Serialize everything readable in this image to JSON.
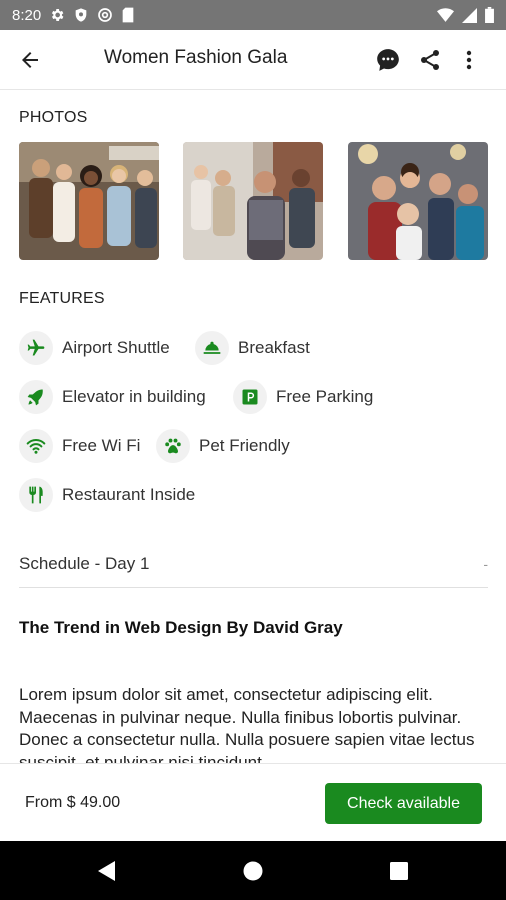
{
  "status_bar": {
    "time": "8:20",
    "left_icons": [
      "gear-icon",
      "shield-icon",
      "at-sign-icon",
      "sim-card-icon"
    ],
    "right_icons": [
      "wifi-icon",
      "signal-icon",
      "battery-icon"
    ]
  },
  "app_bar": {
    "title": "Women Fashion Gala",
    "back_icon": "arrow-back-icon",
    "actions": [
      "chat-icon",
      "share-icon",
      "more-vert-icon"
    ]
  },
  "photos": {
    "label": "PHOTOS",
    "items": [
      "photo-group-smiling",
      "photo-audience-seated",
      "photo-selfie-group"
    ]
  },
  "features": {
    "label": "FEATURES",
    "items": [
      {
        "label": "Airport Shuttle",
        "icon": "airplane-icon"
      },
      {
        "label": "Breakfast",
        "icon": "room-service-icon"
      },
      {
        "label": "Elevator in building",
        "icon": "rocket-icon"
      },
      {
        "label": "Free Parking",
        "icon": "parking-icon"
      },
      {
        "label": "Free Wi Fi",
        "icon": "wifi-icon"
      },
      {
        "label": "Pet Friendly",
        "icon": "paw-icon"
      },
      {
        "label": "Restaurant Inside",
        "icon": "restaurant-icon"
      }
    ]
  },
  "schedule": {
    "label": "Schedule - Day 1",
    "toggle": "-"
  },
  "session": {
    "title": "The Trend in Web Design By David Gray",
    "description": "Lorem ipsum dolor sit amet, consectetur adipiscing elit. Maecenas in pulvinar neque. Nulla finibus lobortis pulvinar. Donec a consectetur nulla. Nulla posuere sapien vitae lectus suscipit, et pulvinar nisi tincidunt."
  },
  "footer": {
    "price": "From $ 49.00",
    "cta_label": "Check available"
  },
  "nav_bar": [
    "back-triangle-icon",
    "home-circle-icon",
    "recents-square-icon"
  ],
  "colors": {
    "accent": "#1a8a1f",
    "status_bar": "#757575",
    "icon_bg": "#f1f1f1"
  }
}
